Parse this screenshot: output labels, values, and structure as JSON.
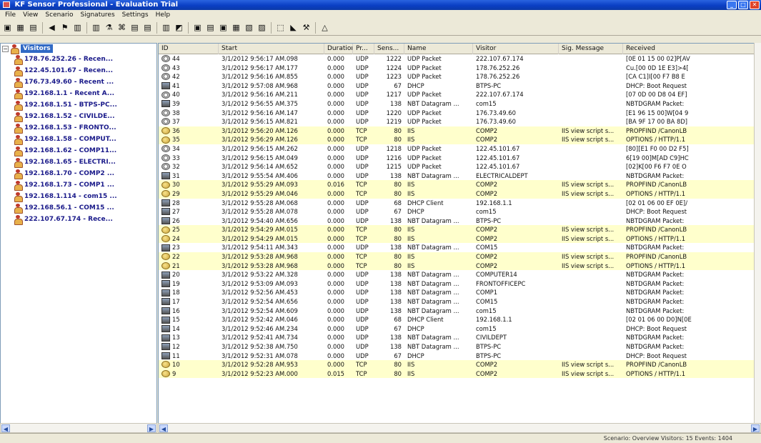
{
  "window": {
    "title": "KF Sensor Professional - Evaluation Trial",
    "controls": [
      "_",
      "□",
      "✕"
    ]
  },
  "menu": [
    "File",
    "View",
    "Scenario",
    "Signatures",
    "Settings",
    "Help"
  ],
  "toolbar": {
    "buttons": [
      "▣",
      "▦",
      "▤",
      "◀",
      "⚑",
      "▥",
      "▥",
      "⚗",
      "⌘",
      "▤",
      "▤",
      "▥",
      "◩",
      "▣",
      "▤",
      "▣",
      "▦",
      "▧",
      "▨",
      "⬚",
      "◣",
      "⚒",
      "△"
    ]
  },
  "tree": {
    "root_label": "Visitors",
    "items": [
      "178.76.252.26 - Recen...",
      "122.45.101.67 - Recen...",
      "176.73.49.60 - Recent ...",
      "192.168.1.1 - Recent A...",
      "192.168.1.51 - BTPS-PC...",
      "192.168.1.52 - CIVILDE...",
      "192.168.1.53 - FRONTO...",
      "192.168.1.58 - COMPUT...",
      "192.168.1.62 - COMP11...",
      "192.168.1.65 - ELECTRI...",
      "192.168.1.70 - COMP2 ...",
      "192.168.1.73 - COMP1 ...",
      "192.168.1.114 - com15 ...",
      "192.168.56.1 - COM15 ...",
      "222.107.67.174 - Rece..."
    ]
  },
  "table": {
    "columns": [
      "ID",
      "Start",
      "Duration",
      "Pr...",
      "Sens...",
      "Name",
      "Visitor",
      "Sig. Message",
      "Received"
    ],
    "rows": [
      {
        "icon": "udp",
        "id": "44",
        "start": "3/1/2012 9:56:17 AM.098",
        "dur": "0.000",
        "pr": "UDP",
        "sens": "1222",
        "name": "UDP Packet",
        "visitor": "222.107.67.174",
        "sig": "",
        "rec": "[0E 01 15 00 02]P[AV"
      },
      {
        "icon": "udp",
        "id": "43",
        "start": "3/1/2012 9:56:17 AM.177",
        "dur": "0.000",
        "pr": "UDP",
        "sens": "1224",
        "name": "UDP Packet",
        "visitor": "178.76.252.26",
        "sig": "",
        "rec": "Cu.[00 0D 1E E3]>4["
      },
      {
        "icon": "udp",
        "id": "42",
        "start": "3/1/2012 9:56:16 AM.855",
        "dur": "0.000",
        "pr": "UDP",
        "sens": "1223",
        "name": "UDP Packet",
        "visitor": "178.76.252.26",
        "sig": "",
        "rec": "[CA C1]I[00 F7 B8 E"
      },
      {
        "icon": "pc",
        "id": "41",
        "start": "3/1/2012 9:57:08 AM.968",
        "dur": "0.000",
        "pr": "UDP",
        "sens": "67",
        "name": "DHCP",
        "visitor": "BTPS-PC",
        "sig": "",
        "rec": "DHCP: Boot Request"
      },
      {
        "icon": "udp",
        "id": "40",
        "start": "3/1/2012 9:56:16 AM.211",
        "dur": "0.000",
        "pr": "UDP",
        "sens": "1217",
        "name": "UDP Packet",
        "visitor": "222.107.67.174",
        "sig": "",
        "rec": "[07 0D 00 D8 04 EF]"
      },
      {
        "icon": "pc",
        "id": "39",
        "start": "3/1/2012 9:56:55 AM.375",
        "dur": "0.000",
        "pr": "UDP",
        "sens": "138",
        "name": "NBT Datagram ...",
        "visitor": "com15",
        "sig": "",
        "rec": "NBTDGRAM Packet:"
      },
      {
        "icon": "udp",
        "id": "38",
        "start": "3/1/2012 9:56:16 AM.147",
        "dur": "0.000",
        "pr": "UDP",
        "sens": "1220",
        "name": "UDP Packet",
        "visitor": "176.73.49.60",
        "sig": "",
        "rec": "[E1 96 15 00]W[04 9"
      },
      {
        "icon": "udp",
        "id": "37",
        "start": "3/1/2012 9:56:15 AM.821",
        "dur": "0.000",
        "pr": "UDP",
        "sens": "1219",
        "name": "UDP Packet",
        "visitor": "176.73.49.60",
        "sig": "",
        "rec": "[BA 9F 17 00 BA 8D]"
      },
      {
        "icon": "iis",
        "id": "36",
        "start": "3/1/2012 9:56:20 AM.126",
        "dur": "0.000",
        "pr": "TCP",
        "sens": "80",
        "name": "IIS",
        "visitor": "COMP2",
        "sig": "IIS view script s...",
        "rec": "PROPFIND /CanonLB"
      },
      {
        "icon": "iis",
        "id": "35",
        "start": "3/1/2012 9:56:29 AM.126",
        "dur": "0.000",
        "pr": "TCP",
        "sens": "80",
        "name": "IIS",
        "visitor": "COMP2",
        "sig": "IIS view script s...",
        "rec": "OPTIONS / HTTP/1.1"
      },
      {
        "icon": "udp",
        "id": "34",
        "start": "3/1/2012 9:56:15 AM.262",
        "dur": "0.000",
        "pr": "UDP",
        "sens": "1218",
        "name": "UDP Packet",
        "visitor": "122.45.101.67",
        "sig": "",
        "rec": "[80][E1 F0 00 D2 F5]"
      },
      {
        "icon": "udp",
        "id": "33",
        "start": "3/1/2012 9:56:15 AM.049",
        "dur": "0.000",
        "pr": "UDP",
        "sens": "1216",
        "name": "UDP Packet",
        "visitor": "122.45.101.67",
        "sig": "",
        "rec": "6[19 00]M[AD C9]HC"
      },
      {
        "icon": "udp",
        "id": "32",
        "start": "3/1/2012 9:56:14 AM.652",
        "dur": "0.000",
        "pr": "UDP",
        "sens": "1215",
        "name": "UDP Packet",
        "visitor": "122.45.101.67",
        "sig": "",
        "rec": "[02]K[00 F6 F7 0E O"
      },
      {
        "icon": "pc",
        "id": "31",
        "start": "3/1/2012 9:55:54 AM.406",
        "dur": "0.000",
        "pr": "UDP",
        "sens": "138",
        "name": "NBT Datagram ...",
        "visitor": "ELECTRICALDEPT",
        "sig": "",
        "rec": "NBTDGRAM Packet:"
      },
      {
        "icon": "iis",
        "id": "30",
        "start": "3/1/2012 9:55:29 AM.093",
        "dur": "0.016",
        "pr": "TCP",
        "sens": "80",
        "name": "IIS",
        "visitor": "COMP2",
        "sig": "IIS view script s...",
        "rec": "PROPFIND /CanonLB"
      },
      {
        "icon": "iis",
        "id": "29",
        "start": "3/1/2012 9:55:29 AM.046",
        "dur": "0.000",
        "pr": "TCP",
        "sens": "80",
        "name": "IIS",
        "visitor": "COMP2",
        "sig": "IIS view script s...",
        "rec": "OPTIONS / HTTP/1.1"
      },
      {
        "icon": "pc",
        "id": "28",
        "start": "3/1/2012 9:55:28 AM.068",
        "dur": "0.000",
        "pr": "UDP",
        "sens": "68",
        "name": "DHCP Client",
        "visitor": "192.168.1.1",
        "sig": "",
        "rec": "[02 01 06 00 EF 0E]/"
      },
      {
        "icon": "pc",
        "id": "27",
        "start": "3/1/2012 9:55:28 AM.078",
        "dur": "0.000",
        "pr": "UDP",
        "sens": "67",
        "name": "DHCP",
        "visitor": "com15",
        "sig": "",
        "rec": "DHCP: Boot Request"
      },
      {
        "icon": "pc",
        "id": "26",
        "start": "3/1/2012 9:54:40 AM.656",
        "dur": "0.000",
        "pr": "UDP",
        "sens": "138",
        "name": "NBT Datagram ...",
        "visitor": "BTPS-PC",
        "sig": "",
        "rec": "NBTDGRAM Packet:"
      },
      {
        "icon": "iis",
        "id": "25",
        "start": "3/1/2012 9:54:29 AM.015",
        "dur": "0.000",
        "pr": "TCP",
        "sens": "80",
        "name": "IIS",
        "visitor": "COMP2",
        "sig": "IIS view script s...",
        "rec": "PROPFIND /CanonLB"
      },
      {
        "icon": "iis",
        "id": "24",
        "start": "3/1/2012 9:54:29 AM.015",
        "dur": "0.000",
        "pr": "TCP",
        "sens": "80",
        "name": "IIS",
        "visitor": "COMP2",
        "sig": "IIS view script s...",
        "rec": "OPTIONS / HTTP/1.1"
      },
      {
        "icon": "pc",
        "id": "23",
        "start": "3/1/2012 9:54:11 AM.343",
        "dur": "0.000",
        "pr": "UDP",
        "sens": "138",
        "name": "NBT Datagram ...",
        "visitor": "COM15",
        "sig": "",
        "rec": "NBTDGRAM Packet:"
      },
      {
        "icon": "iis",
        "id": "22",
        "start": "3/1/2012 9:53:28 AM.968",
        "dur": "0.000",
        "pr": "TCP",
        "sens": "80",
        "name": "IIS",
        "visitor": "COMP2",
        "sig": "IIS view script s...",
        "rec": "PROPFIND /CanonLB"
      },
      {
        "icon": "iis",
        "id": "21",
        "start": "3/1/2012 9:53:28 AM.968",
        "dur": "0.000",
        "pr": "TCP",
        "sens": "80",
        "name": "IIS",
        "visitor": "COMP2",
        "sig": "IIS view script s...",
        "rec": "OPTIONS / HTTP/1.1"
      },
      {
        "icon": "pc",
        "id": "20",
        "start": "3/1/2012 9:53:22 AM.328",
        "dur": "0.000",
        "pr": "UDP",
        "sens": "138",
        "name": "NBT Datagram ...",
        "visitor": "COMPUTER14",
        "sig": "",
        "rec": "NBTDGRAM Packet:"
      },
      {
        "icon": "pc",
        "id": "19",
        "start": "3/1/2012 9:53:09 AM.093",
        "dur": "0.000",
        "pr": "UDP",
        "sens": "138",
        "name": "NBT Datagram ...",
        "visitor": "FRONTOFFICEPC",
        "sig": "",
        "rec": "NBTDGRAM Packet:"
      },
      {
        "icon": "pc",
        "id": "18",
        "start": "3/1/2012 9:52:56 AM.453",
        "dur": "0.000",
        "pr": "UDP",
        "sens": "138",
        "name": "NBT Datagram ...",
        "visitor": "COMP1",
        "sig": "",
        "rec": "NBTDGRAM Packet:"
      },
      {
        "icon": "pc",
        "id": "17",
        "start": "3/1/2012 9:52:54 AM.656",
        "dur": "0.000",
        "pr": "UDP",
        "sens": "138",
        "name": "NBT Datagram ...",
        "visitor": "COM15",
        "sig": "",
        "rec": "NBTDGRAM Packet:"
      },
      {
        "icon": "pc",
        "id": "16",
        "start": "3/1/2012 9:52:54 AM.609",
        "dur": "0.000",
        "pr": "UDP",
        "sens": "138",
        "name": "NBT Datagram ...",
        "visitor": "com15",
        "sig": "",
        "rec": "NBTDGRAM Packet:"
      },
      {
        "icon": "pc",
        "id": "15",
        "start": "3/1/2012 9:52:42 AM.046",
        "dur": "0.000",
        "pr": "UDP",
        "sens": "68",
        "name": "DHCP Client",
        "visitor": "192.168.1.1",
        "sig": "",
        "rec": "[02 01 06 00 D0]N[0E"
      },
      {
        "icon": "pc",
        "id": "14",
        "start": "3/1/2012 9:52:46 AM.234",
        "dur": "0.000",
        "pr": "UDP",
        "sens": "67",
        "name": "DHCP",
        "visitor": "com15",
        "sig": "",
        "rec": "DHCP: Boot Request"
      },
      {
        "icon": "pc",
        "id": "13",
        "start": "3/1/2012 9:52:41 AM.734",
        "dur": "0.000",
        "pr": "UDP",
        "sens": "138",
        "name": "NBT Datagram ...",
        "visitor": "CIVILDEPT",
        "sig": "",
        "rec": "NBTDGRAM Packet:"
      },
      {
        "icon": "pc",
        "id": "12",
        "start": "3/1/2012 9:52:38 AM.750",
        "dur": "0.000",
        "pr": "UDP",
        "sens": "138",
        "name": "NBT Datagram ...",
        "visitor": "BTPS-PC",
        "sig": "",
        "rec": "NBTDGRAM Packet:"
      },
      {
        "icon": "pc",
        "id": "11",
        "start": "3/1/2012 9:52:31 AM.078",
        "dur": "0.000",
        "pr": "UDP",
        "sens": "67",
        "name": "DHCP",
        "visitor": "BTPS-PC",
        "sig": "",
        "rec": "DHCP: Boot Request"
      },
      {
        "icon": "iis",
        "id": "10",
        "start": "3/1/2012 9:52:28 AM.953",
        "dur": "0.000",
        "pr": "TCP",
        "sens": "80",
        "name": "IIS",
        "visitor": "COMP2",
        "sig": "IIS view script s...",
        "rec": "PROPFIND /CanonLB"
      },
      {
        "icon": "iis",
        "id": "9",
        "start": "3/1/2012 9:52:23 AM.000",
        "dur": "0.015",
        "pr": "TCP",
        "sens": "80",
        "name": "IIS",
        "visitor": "COMP2",
        "sig": "IIS view script s...",
        "rec": "OPTIONS / HTTP/1.1"
      }
    ]
  },
  "status": {
    "text": "Scenario: Overview   Visitors: 15   Events: 1404"
  }
}
